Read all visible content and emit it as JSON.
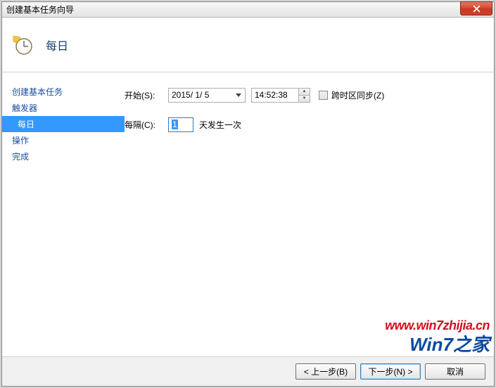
{
  "window": {
    "title": "创建基本任务向导"
  },
  "header": {
    "title": "每日"
  },
  "sidebar": {
    "items": [
      {
        "label": "创建基本任务",
        "indent": false,
        "selected": false
      },
      {
        "label": "触发器",
        "indent": false,
        "selected": false
      },
      {
        "label": "每日",
        "indent": true,
        "selected": true
      },
      {
        "label": "操作",
        "indent": false,
        "selected": false
      },
      {
        "label": "完成",
        "indent": false,
        "selected": false
      }
    ]
  },
  "form": {
    "start_label": "开始(S):",
    "date_value": "2015/ 1/ 5",
    "time_value": "14:52:38",
    "sync_tz_label": "跨时区同步(Z)",
    "recur_label": "每隔(C):",
    "recur_value": "1",
    "recur_suffix": "天发生一次"
  },
  "footer": {
    "back": "< 上一步(B)",
    "next": "下一步(N) >",
    "cancel": "取消"
  },
  "watermark": {
    "url": "www.win7zhijia.cn",
    "logo": "Win7之家"
  }
}
